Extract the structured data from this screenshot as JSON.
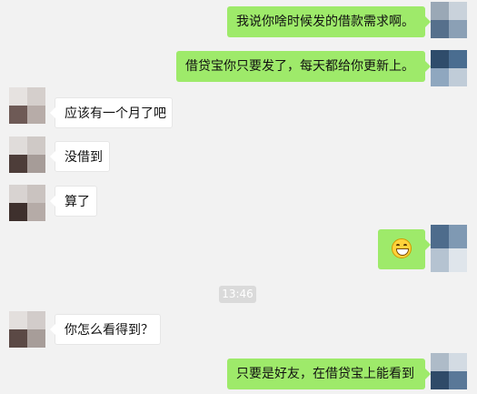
{
  "messages": [
    {
      "side": "right",
      "text": "我说你啥时候发的借款需求啊。"
    },
    {
      "side": "right",
      "text": "借贷宝你只要发了，每天都给你更新上。"
    },
    {
      "side": "left",
      "text": "应该有一个月了吧"
    },
    {
      "side": "left",
      "text": "没借到"
    },
    {
      "side": "left",
      "text": "算了"
    },
    {
      "side": "right",
      "emoji": "grin-emoji"
    },
    {
      "side": "left",
      "text": "你怎么看得到？"
    },
    {
      "side": "right",
      "text": "只要是好友，在借贷宝上能看到"
    }
  ],
  "timestamp": "13:46",
  "colors": {
    "background": "#f2f2f2",
    "bubble_self": "#9eea6a",
    "bubble_other": "#ffffff",
    "timestamp_bg": "#dadada"
  },
  "icons": {
    "self_avatar": "blurred-avatar",
    "other_avatar": "blurred-avatar",
    "emoji": "grin-emoji"
  }
}
